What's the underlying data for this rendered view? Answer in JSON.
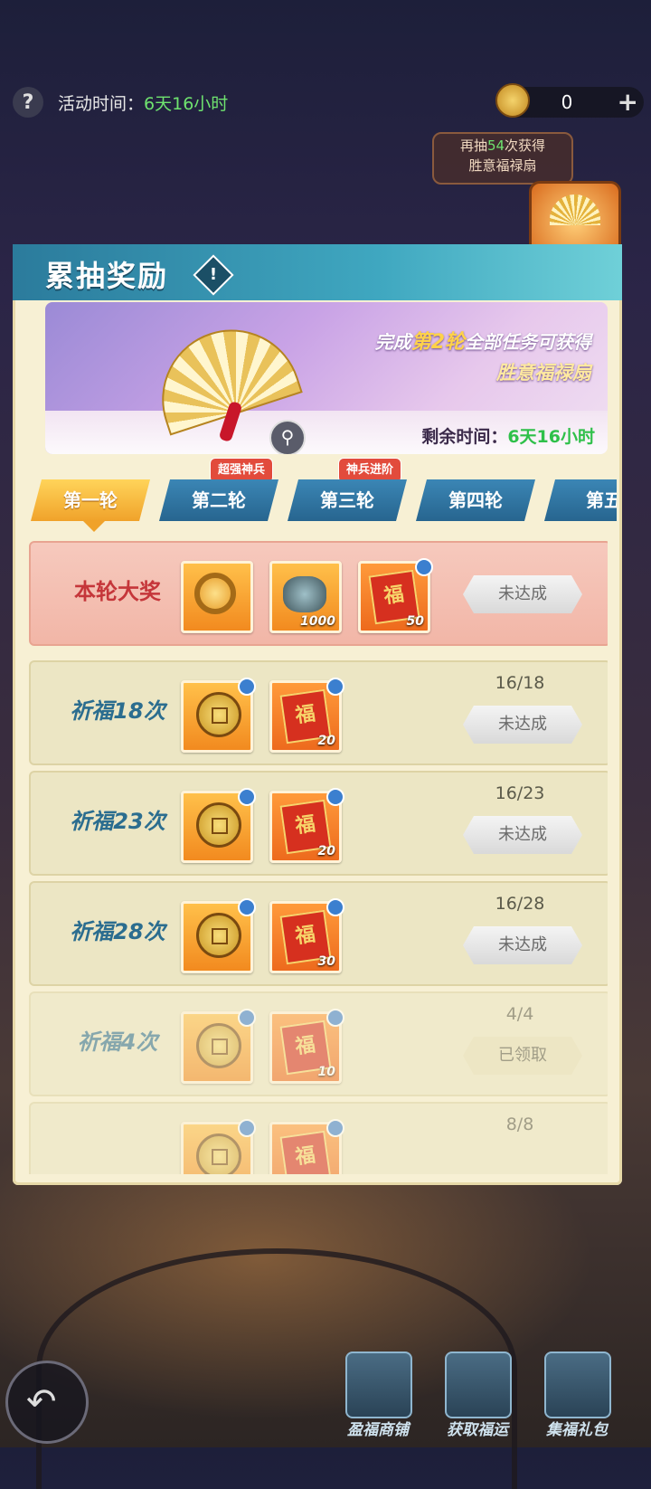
{
  "top": {
    "help": "?",
    "activity_label": "活动时间：",
    "activity_value": "6天16小时",
    "currency_count": "0",
    "plus": "+",
    "tip_pre": "再抽",
    "tip_num": "54",
    "tip_post": "次获得",
    "tip_line2": "胜意福禄扇"
  },
  "panel": {
    "title": "累抽奖励",
    "info": "!"
  },
  "banner": {
    "line1_pre": "完成",
    "line1_hl": "第2轮",
    "line1_post": "全部任务可获得",
    "line2": "胜意福禄扇",
    "remain_label": "剩余时间：",
    "remain_value": "6天16小时"
  },
  "tabs": [
    {
      "label": "第一轮",
      "active": true
    },
    {
      "label": "第二轮"
    },
    {
      "label": "第三轮"
    },
    {
      "label": "第四轮"
    },
    {
      "label": "第五"
    }
  ],
  "badges": [
    "超强神兵",
    "神兵进阶"
  ],
  "rows": [
    {
      "label": "本轮大奖",
      "items": [
        {
          "icon": "ring-icon",
          "qty": ""
        },
        {
          "icon": "ore-icon",
          "qty": "1000"
        },
        {
          "icon": "fu-card-icon",
          "qty": "50",
          "timed": true
        }
      ],
      "progress": "",
      "status": "未达成"
    },
    {
      "label": "祈福18次",
      "items": [
        {
          "icon": "coin-icon",
          "qty": "",
          "timed": true
        },
        {
          "icon": "fu-card-icon",
          "qty": "20",
          "timed": true
        }
      ],
      "progress": "16/18",
      "status": "未达成"
    },
    {
      "label": "祈福23次",
      "items": [
        {
          "icon": "coin-icon",
          "qty": "",
          "timed": true
        },
        {
          "icon": "fu-card-icon",
          "qty": "20",
          "timed": true
        }
      ],
      "progress": "16/23",
      "status": "未达成"
    },
    {
      "label": "祈福28次",
      "items": [
        {
          "icon": "coin-icon",
          "qty": "",
          "timed": true
        },
        {
          "icon": "fu-card-icon",
          "qty": "30",
          "timed": true
        }
      ],
      "progress": "16/28",
      "status": "未达成"
    },
    {
      "label": "祈福4次",
      "items": [
        {
          "icon": "coin-icon",
          "qty": "",
          "timed": true
        },
        {
          "icon": "fu-card-icon",
          "qty": "10",
          "timed": true
        }
      ],
      "progress": "4/4",
      "status": "已领取"
    },
    {
      "label": "",
      "items": [
        {
          "icon": "coin-icon",
          "qty": "",
          "timed": true
        },
        {
          "icon": "fu-card-icon",
          "qty": "",
          "timed": true
        }
      ],
      "progress": "8/8",
      "status": ""
    }
  ],
  "nav": [
    {
      "label": "盈福商铺",
      "icon": "shop-chest-icon"
    },
    {
      "label": "获取福运",
      "icon": "fortune-book-icon"
    },
    {
      "label": "集福礼包",
      "icon": "gift-box-icon"
    }
  ],
  "card_glyph": "福"
}
